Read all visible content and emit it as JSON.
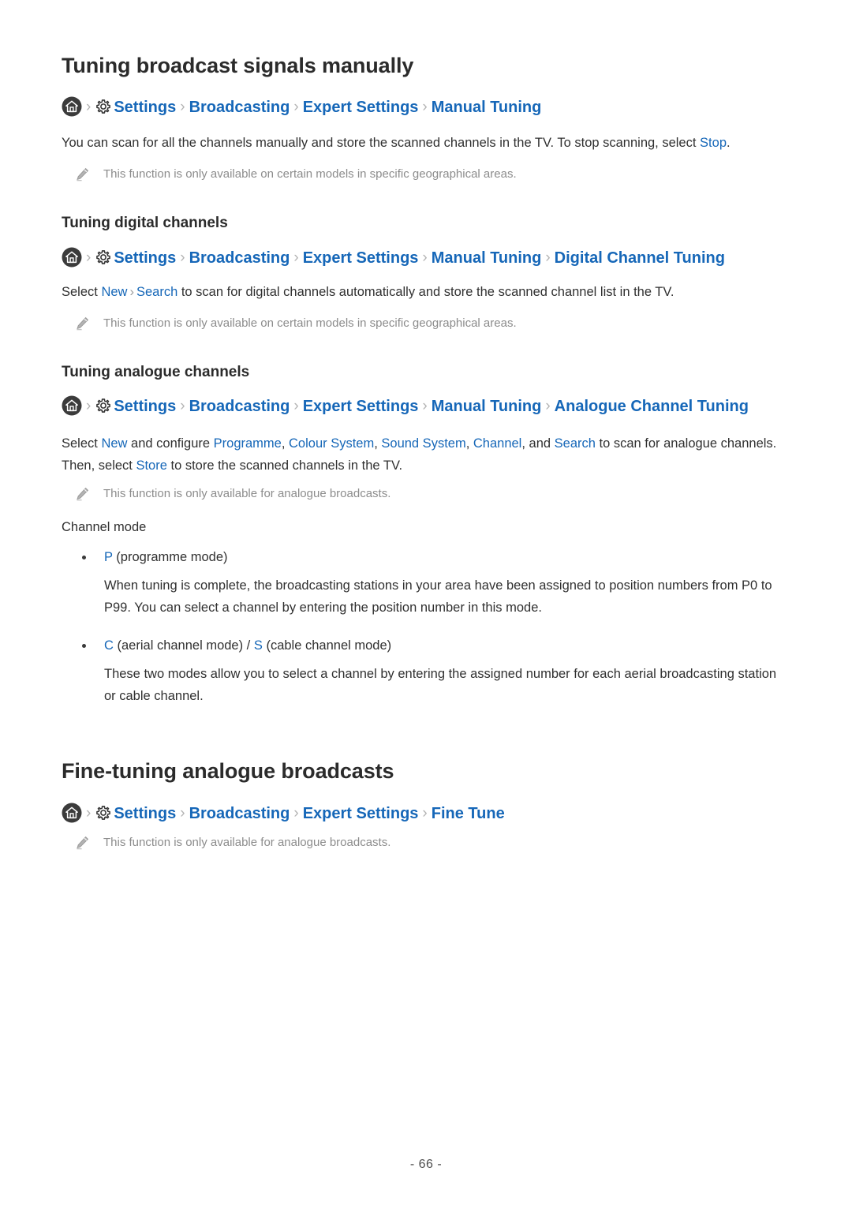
{
  "document": {
    "page_number_label": "- 66 -",
    "accent_link_color": "#1667b8",
    "heading_color": "#2b2b2b",
    "note_color": "#8c8c8c",
    "separator_color": "#b4b4b4"
  },
  "section_manual_tuning": {
    "heading": "Tuning broadcast signals manually",
    "breadcrumb": {
      "home_icon": "home-icon",
      "gear_icon": "gear-icon",
      "separator": "›",
      "items": [
        "Settings",
        "Broadcasting",
        "Expert Settings",
        "Manual Tuning"
      ]
    },
    "paragraph": {
      "part1": "You can scan for all the channels manually and store the scanned channels in the TV. To stop scanning, select ",
      "link1": "Stop",
      "part2": "."
    },
    "note": {
      "icon": "pencil-icon",
      "text": "This function is only available on certain models in specific geographical areas."
    }
  },
  "subsection_digital": {
    "heading": "Tuning digital channels",
    "breadcrumb": {
      "home_icon": "home-icon",
      "gear_icon": "gear-icon",
      "separator": "›",
      "items": [
        "Settings",
        "Broadcasting",
        "Expert Settings",
        "Manual Tuning",
        "Digital Channel Tuning"
      ]
    },
    "paragraph": {
      "part1": "Select ",
      "link1": "New",
      "sep1": "›",
      "link2": "Search",
      "part2": " to scan for digital channels automatically and store the scanned channel list in the TV."
    },
    "note": {
      "icon": "pencil-icon",
      "text": "This function is only available on certain models in specific geographical areas."
    }
  },
  "subsection_analogue": {
    "heading": "Tuning analogue channels",
    "breadcrumb": {
      "home_icon": "home-icon",
      "gear_icon": "gear-icon",
      "separator": "›",
      "items": [
        "Settings",
        "Broadcasting",
        "Expert Settings",
        "Manual Tuning",
        "Analogue Channel Tuning"
      ]
    },
    "paragraph": {
      "part1": "Select ",
      "link1": "New",
      "part2": " and configure ",
      "link2": "Programme",
      "part3": ", ",
      "link3": "Colour System",
      "part4": ", ",
      "link4": "Sound System",
      "part5": ", ",
      "link5": "Channel",
      "part6": ", and ",
      "link6": "Search",
      "part7": " to scan for analogue channels. Then, select ",
      "link7": "Store",
      "part8": " to store the scanned channels in the TV."
    },
    "note": {
      "icon": "pencil-icon",
      "text": "This function is only available for analogue broadcasts."
    },
    "channel_mode_label": "Channel mode",
    "bullets": [
      {
        "label_link": "P",
        "label_rest": " (programme mode)",
        "body": "When tuning is complete, the broadcasting stations in your area have been assigned to position numbers from P0 to P99. You can select a channel by entering the position number in this mode."
      },
      {
        "label_link_a": "C",
        "label_mid_a": " (aerial channel mode) / ",
        "label_link_b": "S",
        "label_rest_b": " (cable channel mode)",
        "body": "These two modes allow you to select a channel by entering the assigned number for each aerial broadcasting station or cable channel."
      }
    ]
  },
  "section_fine_tuning": {
    "heading": "Fine-tuning analogue broadcasts",
    "breadcrumb": {
      "home_icon": "home-icon",
      "gear_icon": "gear-icon",
      "separator": "›",
      "items": [
        "Settings",
        "Broadcasting",
        "Expert Settings",
        "Fine Tune"
      ]
    },
    "note": {
      "icon": "pencil-icon",
      "text": "This function is only available for analogue broadcasts."
    }
  }
}
